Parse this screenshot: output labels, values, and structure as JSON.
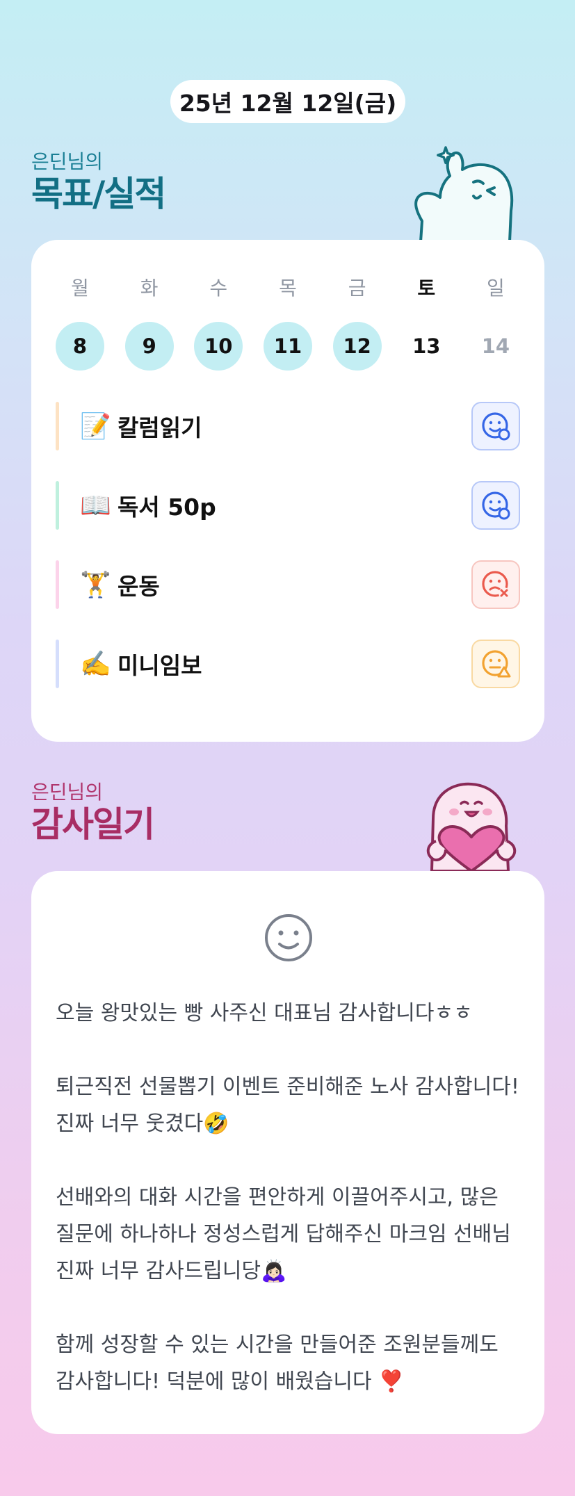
{
  "header": {
    "date": "25년 12월 12일(금)"
  },
  "goals_section": {
    "subtitle": "은딘님의",
    "title": "목표/실적",
    "weekdays": [
      "월",
      "화",
      "수",
      "목",
      "금",
      "토",
      "일"
    ],
    "dates": [
      "8",
      "9",
      "10",
      "11",
      "12",
      "13",
      "14"
    ],
    "items": [
      {
        "emoji": "📝",
        "label": "칼럼읽기",
        "status": "success",
        "bar_color": "#fde2c3",
        "icon": "smile-check-icon"
      },
      {
        "emoji": "📖",
        "label": "독서 50p",
        "status": "success",
        "bar_color": "#bff0de",
        "icon": "smile-check-icon"
      },
      {
        "emoji": "🏋",
        "label": "운동",
        "status": "fail",
        "bar_color": "#fcd3ea",
        "icon": "frown-x-icon"
      },
      {
        "emoji": "✍️",
        "label": "미니임보",
        "status": "partial",
        "bar_color": "#d5defc",
        "icon": "meh-warning-icon"
      }
    ],
    "colors": {
      "success": "#3566e6",
      "fail": "#ea5a4d",
      "partial": "#f2a230",
      "done_day": "#c3eef3"
    }
  },
  "gratitude_section": {
    "subtitle": "은딘님의",
    "title": "감사일기",
    "mood_icon": "smiley-face-icon",
    "entries": [
      "오늘 왕맛있는 빵 사주신 대표님 감사합니다ㅎㅎ",
      "퇴근직전 선물뽑기 이벤트 준비해준 노사 감사합니다! 진짜 너무 웃겼다🤣",
      "선배와의 대화 시간을 편안하게 이끌어주시고, 많은 질문에 하나하나 정성스럽게 답해주신 마크임 선배님 진짜 너무 감사드립니당🙇🏻‍♀️",
      "함께 성장할 수 있는 시간을 만들어준 조원분들께도 감사합니다! 덕분에 많이 배웠습니다 ❣️"
    ]
  }
}
